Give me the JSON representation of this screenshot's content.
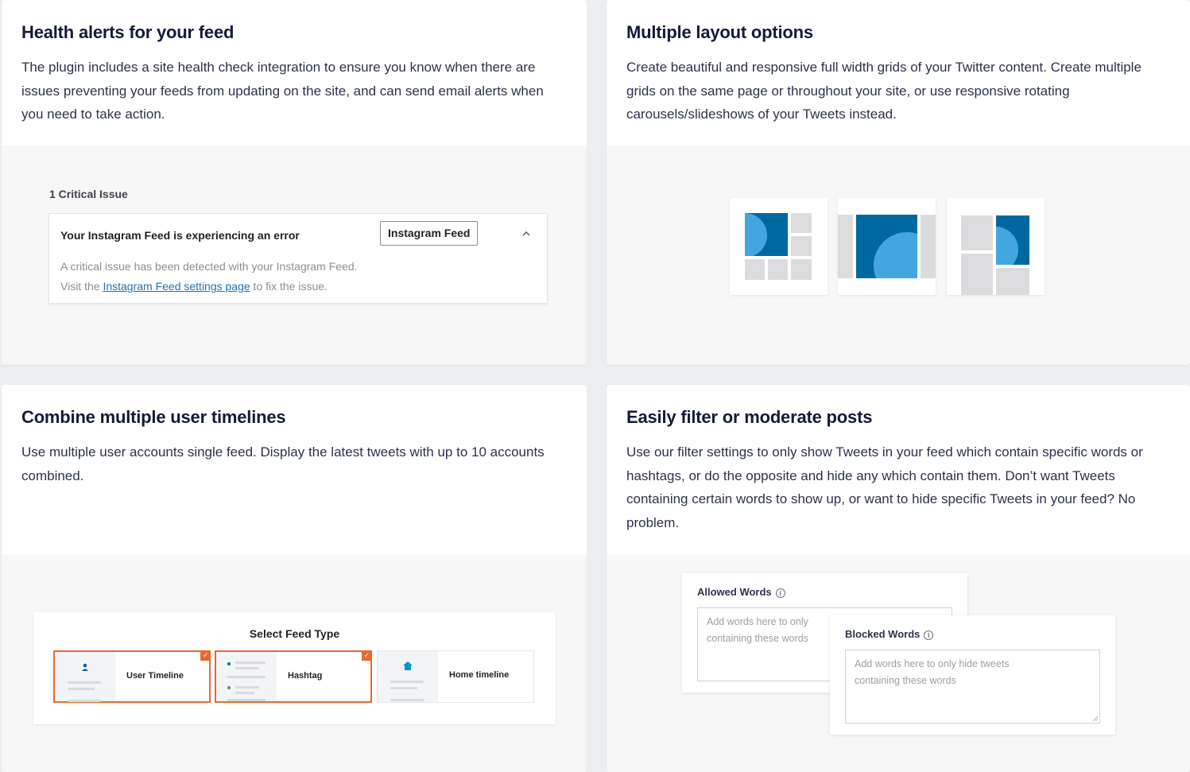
{
  "cards": [
    {
      "title": "Health alerts for your feed",
      "description": "The plugin includes a site health check integration to ensure you know when there are issues preventing your feeds from updating on the site, and can send email alerts when you need to take action."
    },
    {
      "title": "Multiple layout options",
      "description": "Create beautiful and responsive full width grids of your Twitter content. Create multiple grids on the same page or throughout your site, or use responsive rotating carousels/slideshows of your Tweets instead."
    },
    {
      "title": "Combine multiple user timelines",
      "description": "Use multiple user accounts single feed. Display the latest tweets with up to 10 accounts combined."
    },
    {
      "title": "Easily filter or moderate posts",
      "description": "Use our filter settings to only show Tweets in your feed which contain specific words or hashtags, or do the opposite and hide any which contain them. Don’t want Tweets containing certain words to show up, or want to hide specific Tweets in your feed? No problem."
    }
  ],
  "health": {
    "critical_count": "1 Critical Issue",
    "alert_title": "Your Instagram Feed is experiencing an error",
    "alert_tag": "Instagram Feed",
    "body_line1": "A critical issue has been detected with your Instagram Feed.",
    "body_line2_prefix": "Visit the ",
    "body_link": "Instagram Feed settings page",
    "body_line2_suffix": " to fix the issue."
  },
  "feed_type": {
    "title": "Select Feed Type",
    "options": [
      {
        "label": "User Timeline",
        "selected": true
      },
      {
        "label": "Hashtag",
        "selected": true
      },
      {
        "label": "Home timeline",
        "selected": false
      }
    ],
    "check_glyph": "✓"
  },
  "filters": {
    "allowed_label": "Allowed Words",
    "allowed_placeholder_1": "Add words here to only",
    "allowed_placeholder_2": "containing these words",
    "blocked_label": "Blocked Words",
    "blocked_placeholder_1": "Add words here to only hide tweets",
    "blocked_placeholder_2": "containing these words",
    "info_glyph": "i"
  },
  "colors": {
    "brand_blue": "#0068a0",
    "light_blue": "#43a6df",
    "select_orange": "#e8692f",
    "link_blue": "#2271b1"
  }
}
